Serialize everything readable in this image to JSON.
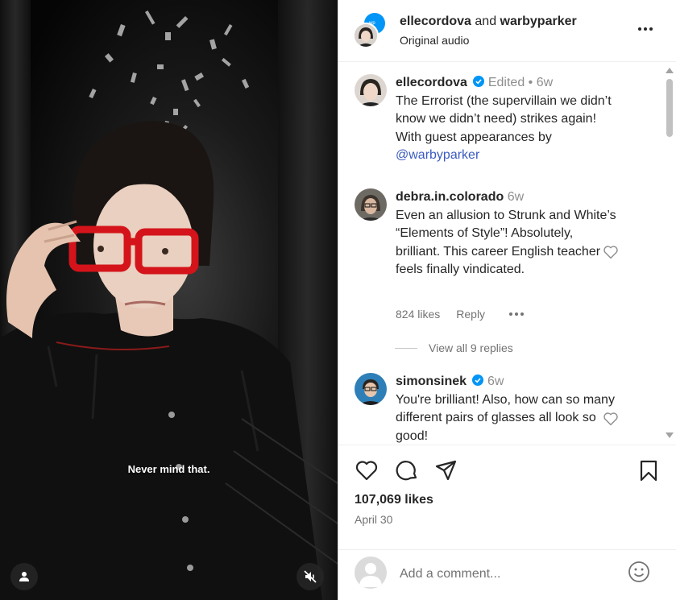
{
  "video": {
    "subtitle": "Never mind that."
  },
  "header": {
    "user1": "ellecordova",
    "conjunction": "and",
    "user2": "warbyparker",
    "audio": "Original audio"
  },
  "caption": {
    "username": "ellecordova",
    "edited": "Edited",
    "separator": "•",
    "age": "6w",
    "text": "The Errorist (the supervillain we didn’t know we didn’t need) strikes again! With guest appearances by",
    "mention": "@warbyparker"
  },
  "comments": [
    {
      "username": "debra.in.colorado",
      "age": "6w",
      "text": "Even an allusion to Strunk and White’s “Elements of Style”! Absolutely, brilliant. This career English teacher feels finally vindicated.",
      "likes": "824 likes",
      "reply": "Reply",
      "view_replies": "View all 9 replies"
    },
    {
      "username": "simonsinek",
      "age": "6w",
      "text": "You're brilliant! Also, how can so many different pairs of glasses all look so good!"
    }
  ],
  "post": {
    "likes": "107,069 likes",
    "date": "April 30"
  },
  "composer": {
    "placeholder": "Add a comment..."
  },
  "colors": {
    "verified": "#0095f6",
    "mention": "#3a5ac0",
    "muted": "#737373",
    "glasses": "#d4141a"
  },
  "icons": [
    "user-icon",
    "mute-icon",
    "more-icon",
    "verified-icon",
    "heart-icon",
    "comment-icon",
    "share-icon",
    "bookmark-icon",
    "emoji-icon"
  ]
}
